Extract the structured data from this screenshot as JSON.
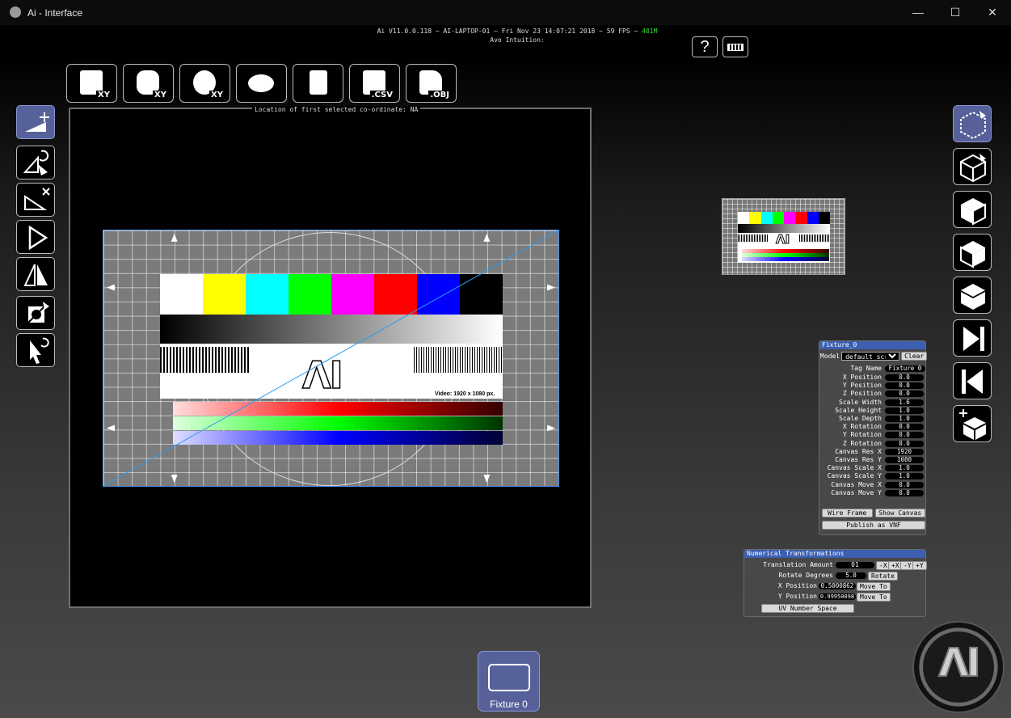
{
  "window": {
    "title": "Ai - Interface",
    "minimize": "—",
    "maximize": "☐",
    "close": "✕"
  },
  "status": {
    "line1": "Ai V11.0.0.118  ~ AI-LAPTOP-01 ~ Fri Nov 23 14:07:21 2018 ~ 59 FPS ~ ",
    "fps_tag": "481M",
    "line2": "Avo Intuition:",
    "fps_color": "#2fe02f"
  },
  "top_buttons": {
    "help": "?",
    "keyboard_icon": "keyboard-icon"
  },
  "toolbar": [
    {
      "name": "square-xy-tool",
      "sub": "XY"
    },
    {
      "name": "cylinder-xy-tool",
      "sub": "XY"
    },
    {
      "name": "sphere-xy-tool",
      "sub": "XY"
    },
    {
      "name": "projector-tool",
      "sub": ""
    },
    {
      "name": "cube-unfold-tool",
      "sub": ""
    },
    {
      "name": "save-csv-tool",
      "sub": ".CSV"
    },
    {
      "name": "save-obj-tool",
      "sub": ".OBJ"
    }
  ],
  "input_panel": {
    "location_label": "Location of first selected co-ordinate: NA"
  },
  "test_card": {
    "video_label": "Video: 1920 x 1080 px.",
    "logo": "ΛI",
    "bar_colors": [
      "#ffffff",
      "#ffff00",
      "#00ffff",
      "#00ff00",
      "#ff00ff",
      "#ff0000",
      "#0000ff",
      "#000000"
    ]
  },
  "left_tools": [
    "move-tool",
    "rotate-tool",
    "scale-tool",
    "flip-tool",
    "mirror-tool",
    "mask-tool",
    "select-tool"
  ],
  "right_views": [
    "view-all",
    "view-front",
    "view-left",
    "view-right",
    "view-top",
    "view-forward",
    "view-back",
    "add-model"
  ],
  "fixture_panel": {
    "title": "Fixture_0",
    "model_label": "Model",
    "model_value": "default_scre",
    "clear": "Clear",
    "tag_label": "Tag Name",
    "tag_value": "Fixture 0",
    "rows": [
      {
        "label": "X Position",
        "value": "0.0"
      },
      {
        "label": "Y Position",
        "value": "0.0"
      },
      {
        "label": "Z Position",
        "value": "0.0"
      },
      {
        "label": "Scale Width",
        "value": "1.6"
      },
      {
        "label": "Scale Height",
        "value": "1.0"
      },
      {
        "label": "Scale Depth",
        "value": "1.0"
      },
      {
        "label": "X Rotation",
        "value": "0.0"
      },
      {
        "label": "Y Rotation",
        "value": "0.0"
      },
      {
        "label": "Z Rotation",
        "value": "0.0"
      },
      {
        "label": "Canvas Res X",
        "value": "1920"
      },
      {
        "label": "Canvas Res Y",
        "value": "1080"
      },
      {
        "label": "Canvas Scale X",
        "value": "1.0"
      },
      {
        "label": "Canvas Scale Y",
        "value": "1.0"
      },
      {
        "label": "Canvas Move X",
        "value": "0.0"
      },
      {
        "label": "Canvas Move Y",
        "value": "0.0"
      }
    ],
    "wire_frame": "Wire Frame",
    "show_canvas": "Show Canvas",
    "publish": "Publish as VNF"
  },
  "num_panel": {
    "title": "Numerical Transformations",
    "translation_label": "Translation Amount",
    "translation_value": "01",
    "minus_x": "-X",
    "plus_x": "+X",
    "minus_y": "-Y",
    "plus_y": "+Y",
    "rotate_label": "Rotate Degrees",
    "rotate_value": "5.0",
    "rotate_btn": "Rotate",
    "xpos_label": "X Position",
    "xpos_value": "0.5000862",
    "ypos_label": "Y Position",
    "ypos_value": "0.99950098",
    "move_to": "Move To",
    "uv": "UV Number Space"
  },
  "fixture_tab": {
    "label": "Fixture 0"
  },
  "logo": {
    "text": "ΛI"
  }
}
